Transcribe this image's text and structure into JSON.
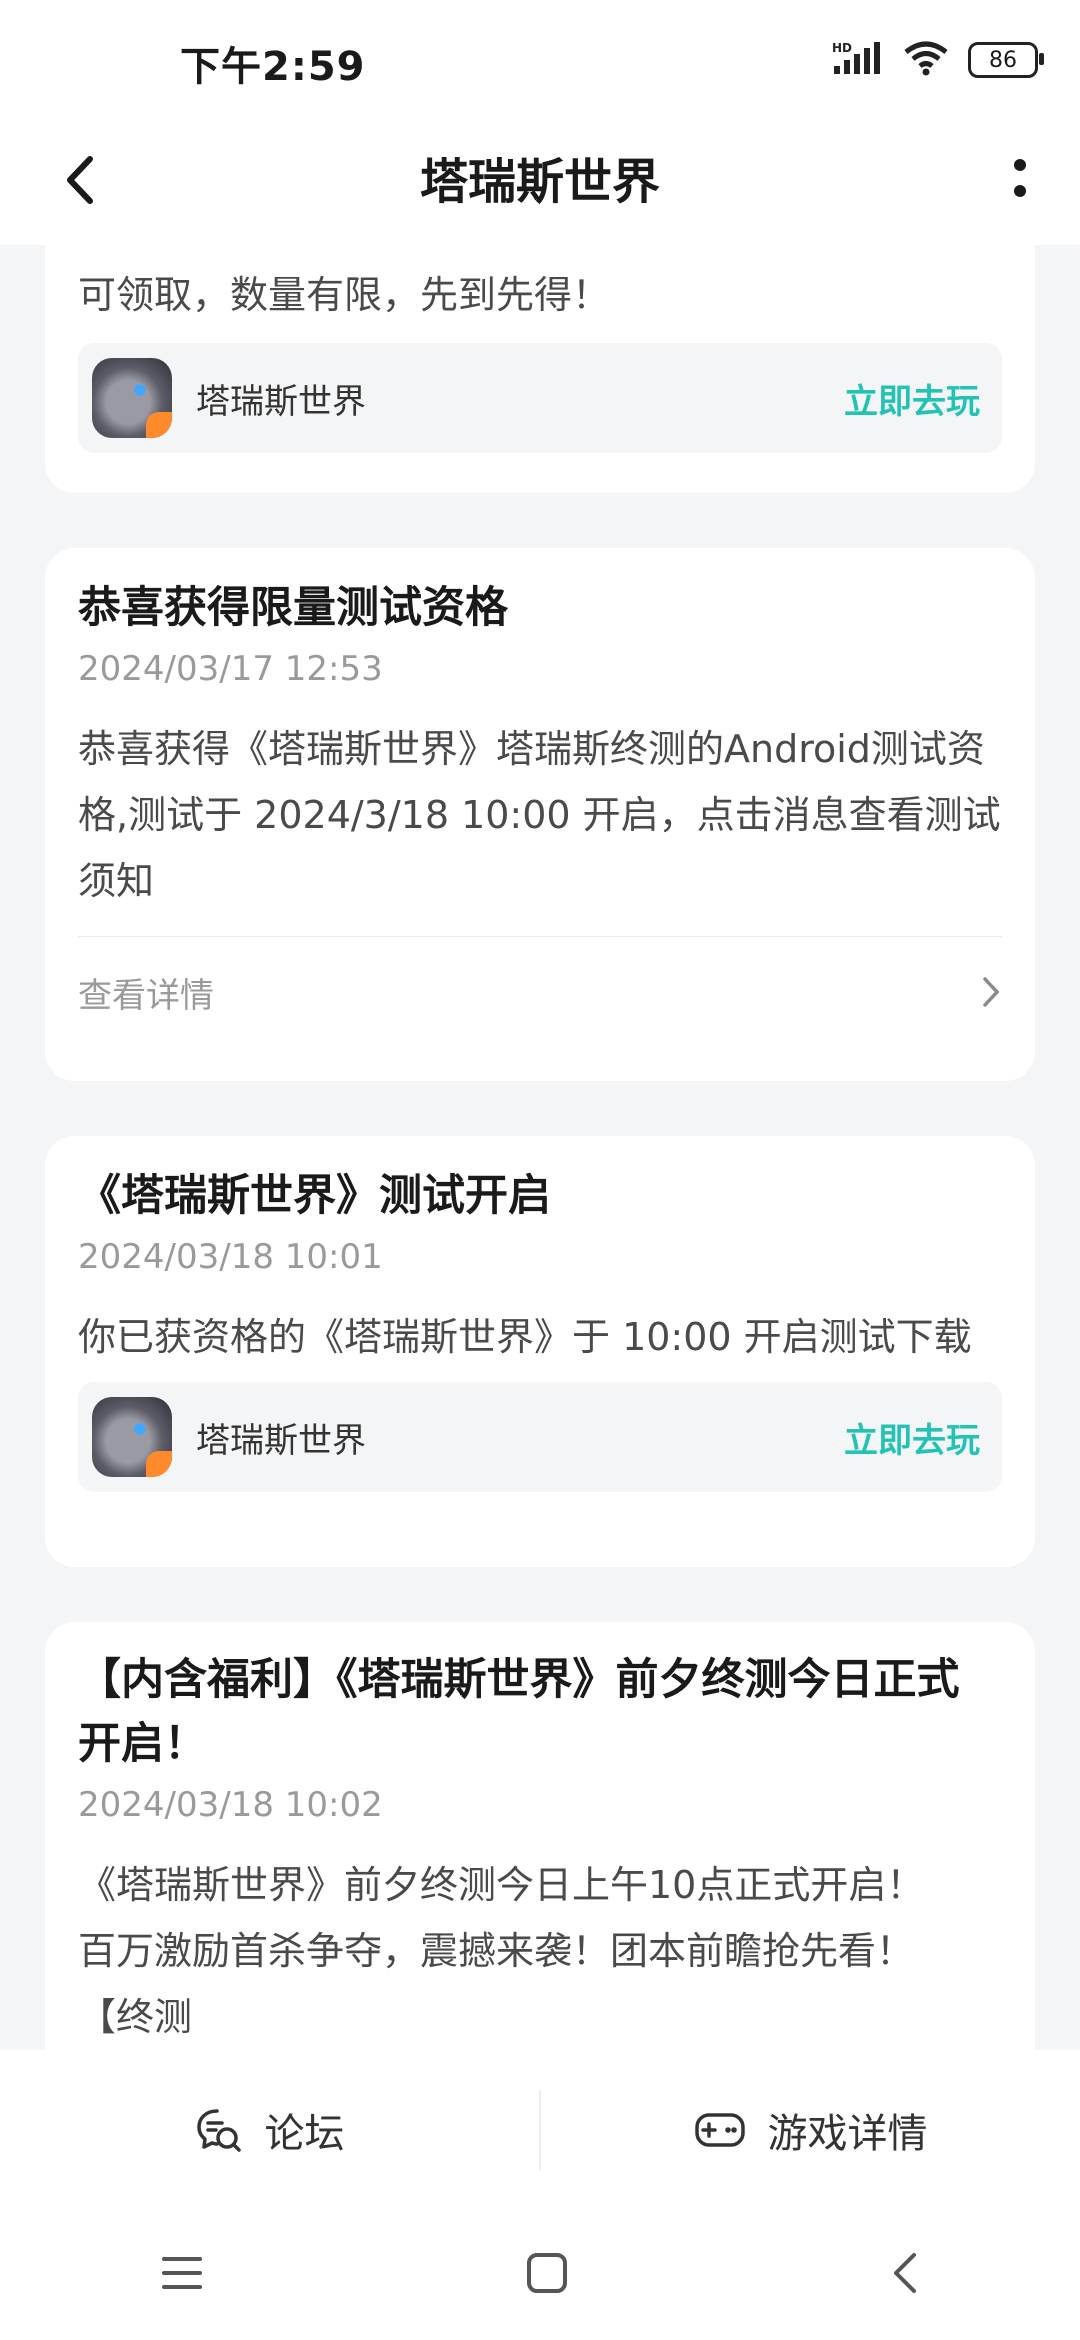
{
  "status_bar": {
    "time": "下午2:59",
    "battery": "86",
    "network_label": "HD"
  },
  "header": {
    "title": "塔瑞斯世界"
  },
  "cards": [
    {
      "body": "可领取，数量有限，先到先得！",
      "app": {
        "name": "塔瑞斯世界",
        "action": "立即去玩"
      }
    },
    {
      "title": "恭喜获得限量测试资格",
      "time": "2024/03/17 12:53",
      "body": "恭喜获得《塔瑞斯世界》塔瑞斯终测的Android测试资格,测试于 2024/3/18 10:00 开启，点击消息查看测试须知",
      "detail": "查看详情"
    },
    {
      "title": "《塔瑞斯世界》测试开启",
      "time": "2024/03/18 10:01",
      "body": "你已获资格的《塔瑞斯世界》于 10:00 开启测试下载",
      "app": {
        "name": "塔瑞斯世界",
        "action": "立即去玩"
      }
    },
    {
      "title": "【内含福利】《塔瑞斯世界》前夕终测今日正式开启！",
      "time": "2024/03/18 10:02",
      "body_line1": "《塔瑞斯世界》前夕终测今日上午10点正式开启！",
      "body_line2": "百万激励首杀争夺，震撼来袭！团本前瞻抢先看！",
      "body_line3": "【终测"
    }
  ],
  "bottom_tabs": [
    {
      "label": "论坛",
      "icon": "chat-icon"
    },
    {
      "label": "游戏详情",
      "icon": "gamepad-icon"
    }
  ],
  "colors": {
    "accent": "#22c3b4",
    "background": "#f4f5f7"
  }
}
